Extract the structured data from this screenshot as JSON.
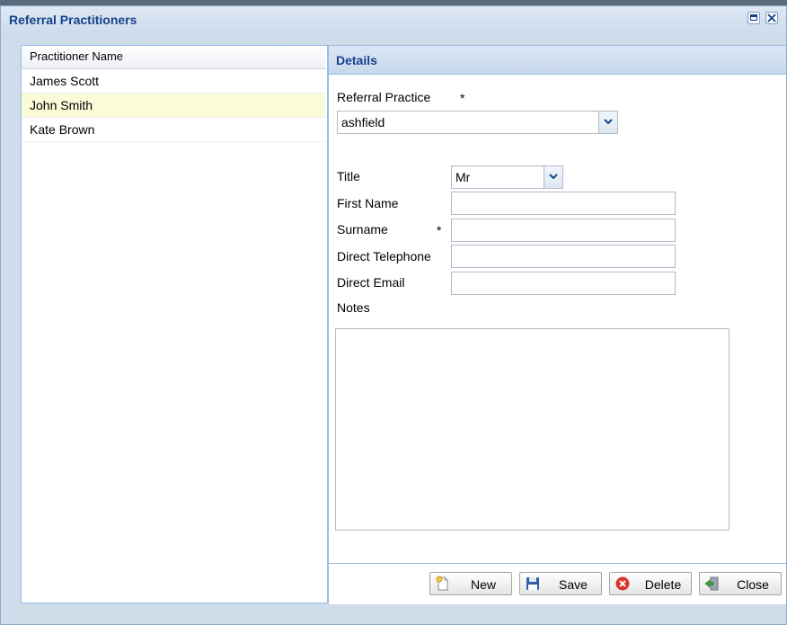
{
  "window": {
    "title": "Referral Practitioners"
  },
  "grid": {
    "column_header": "Practitioner Name",
    "rows": [
      "James Scott",
      "John Smith",
      "Kate Brown"
    ],
    "selected_index": 1
  },
  "details": {
    "title": "Details",
    "referral_practice": {
      "label": "Referral Practice",
      "required": "*",
      "value": "ashfield"
    },
    "title_field": {
      "label": "Title",
      "value": "Mr"
    },
    "first_name": {
      "label": "First Name",
      "value": ""
    },
    "surname": {
      "label": "Surname",
      "required": "*",
      "value": ""
    },
    "direct_telephone": {
      "label": "Direct Telephone",
      "value": ""
    },
    "direct_email": {
      "label": "Direct Email",
      "value": ""
    },
    "notes": {
      "label": "Notes",
      "value": ""
    }
  },
  "buttons": {
    "new": "New",
    "save": "Save",
    "delete": "Delete",
    "close": "Close"
  },
  "colors": {
    "accent_title": "#15428b",
    "panel_border": "#99bbe8",
    "selected_row": "#fbfbd7"
  }
}
